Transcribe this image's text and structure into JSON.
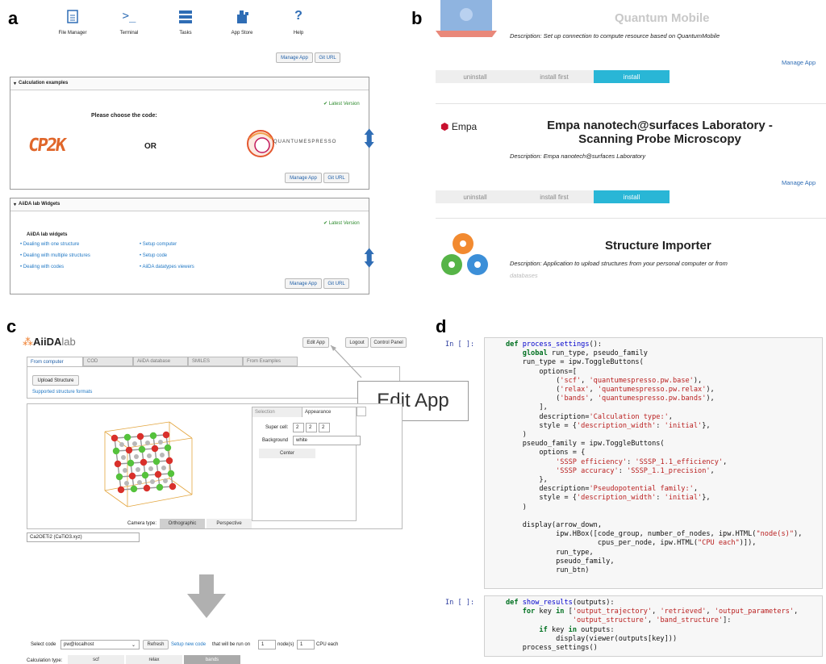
{
  "labels": {
    "a": "a",
    "b": "b",
    "c": "c",
    "d": "d"
  },
  "a": {
    "toolbar": [
      {
        "icon": "file-manager-icon",
        "label": "File Manager"
      },
      {
        "icon": "terminal-icon",
        "label": "Terminal"
      },
      {
        "icon": "tasks-icon",
        "label": "Tasks"
      },
      {
        "icon": "app-store-icon",
        "label": "App Store"
      },
      {
        "icon": "help-icon",
        "label": "Help"
      }
    ],
    "terminal_glyph": ">_",
    "help_glyph": "?",
    "manage_app": "Manage App",
    "git_url": "Git URL",
    "calc": {
      "title": "Calculation examples",
      "latest": "Latest Version",
      "prompt": "Please choose the code:",
      "or": "OR",
      "cp2k": "CP2K",
      "qe": "QUANTUMESPRESSO"
    },
    "widgets": {
      "title": "AiiDA lab Widgets",
      "latest": "Latest Version",
      "heading": "AiiDA lab widgets",
      "left": [
        "Dealing with one structure",
        "Dealing with multiple structures",
        "Dealing with codes"
      ],
      "right": [
        "Setup computer",
        "Setup code",
        "AiiDA datatypes viewers"
      ]
    }
  },
  "b": {
    "quantum": {
      "title": "Quantum Mobile",
      "desc": "Description: Set up connection to compute resource based on QuantumMobile"
    },
    "manage_app": "Manage App",
    "buttons": [
      "uninstall",
      "install first",
      "install"
    ],
    "empa": {
      "logo": "Empa",
      "title1": "Empa nanotech@surfaces Laboratory -",
      "title2": "Scanning Probe Microscopy",
      "desc": "Description: Empa nanotech@surfaces Laboratory"
    },
    "importer": {
      "title": "Structure Importer",
      "desc1": "Description: Application to upload structures from your personal computer or from",
      "desc2": "databases"
    }
  },
  "c": {
    "logo_a": "AiiDA",
    "logo_b": "lab",
    "edit_app": "Edit App",
    "logout": "Logout",
    "control_panel": "Control Panel",
    "tabs": [
      "From computer",
      "COD",
      "AiiDA database",
      "SMILES",
      "From Examples"
    ],
    "upload": "Upload Structure",
    "supported": "Supported structure formats",
    "callout": "Edit App",
    "viewer_tabs": [
      "Selection",
      "Appearance"
    ],
    "supercell_label": "Super cell:",
    "supercell": [
      "2",
      "2",
      "2"
    ],
    "background_label": "Background",
    "background": "white",
    "center": "Center",
    "camera_label": "Camera type:",
    "camera": [
      "Orthographic",
      "Perspective"
    ],
    "structure_name": "Ca2OETi2 (CaTiO3.xyz)",
    "select_code_label": "Select code",
    "select_code": "pw@localhost",
    "refresh": "Refresh",
    "setup_new_code": "Setup new code",
    "run_on": "that will be run on",
    "nodes": "1",
    "nodes_label": "node(s)",
    "cpus": "1",
    "cpus_label": "CPU each",
    "calc_type_label": "Calculation type:",
    "calc_types": [
      "scf",
      "relax",
      "bands"
    ]
  },
  "d": {
    "prompt1": "In [ ]:",
    "prompt2": "In [ ]:"
  },
  "colors": {
    "accent": "#29b6d6",
    "link": "#1f77c4",
    "green": "#2e8b2e",
    "arrow": "#b0b0b0"
  }
}
